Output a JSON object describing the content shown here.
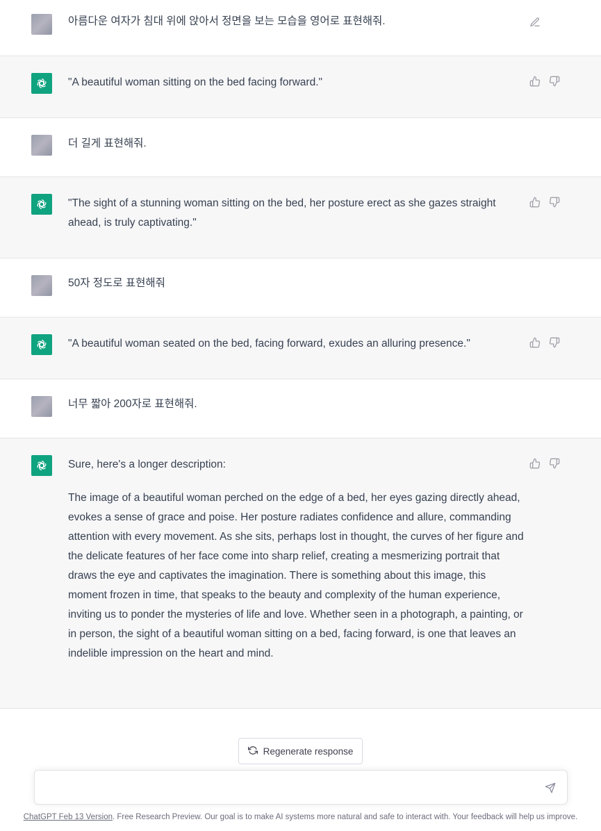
{
  "messages": [
    {
      "role": "user",
      "text": [
        "아름다운 여자가 침대 위에 앉아서 정면을 보는 모습을 영어로 표현해줘."
      ]
    },
    {
      "role": "assistant",
      "text": [
        "\"A beautiful woman sitting on the bed facing forward.\""
      ]
    },
    {
      "role": "user",
      "text": [
        "더 길게 표현해줘."
      ]
    },
    {
      "role": "assistant",
      "text": [
        "\"The sight of a stunning woman sitting on the bed, her posture erect as she gazes straight ahead, is truly captivating.\""
      ]
    },
    {
      "role": "user",
      "text": [
        "50자 정도로 표현해줘"
      ]
    },
    {
      "role": "assistant",
      "text": [
        "\"A beautiful woman seated on the bed, facing forward, exudes an alluring presence.\""
      ]
    },
    {
      "role": "user",
      "text": [
        "너무 짧아 200자로 표현해줘."
      ]
    },
    {
      "role": "assistant",
      "text": [
        "Sure, here's a longer description:",
        "The image of a beautiful woman perched on the edge of a bed, her eyes gazing directly ahead, evokes a sense of grace and poise. Her posture radiates confidence and allure, commanding attention with every movement. As she sits, perhaps lost in thought, the curves of her figure and the delicate features of her face come into sharp relief, creating a mesmerizing portrait that draws the eye and captivates the imagination. There is something about this image, this moment frozen in time, that speaks to the beauty and complexity of the human experience, inviting us to ponder the mysteries of life and love. Whether seen in a photograph, a painting, or in person, the sight of a beautiful woman sitting on a bed, facing forward, is one that leaves an indelible impression on the heart and mind."
      ]
    }
  ],
  "icons": {
    "user_action": "edit-icon",
    "assistant_actions": [
      "thumbs-up-icon",
      "thumbs-down-icon"
    ],
    "regenerate": "refresh-icon",
    "send": "send-icon"
  },
  "regenerate_label": "Regenerate response",
  "composer": {
    "placeholder": "",
    "value": ""
  },
  "footer": {
    "link_text": "ChatGPT Feb 13 Version",
    "text": ". Free Research Preview. Our goal is to make AI systems more natural and safe to interact with. Your feedback will help us improve."
  },
  "colors": {
    "assistant_avatar": "#10a37f",
    "assistant_bg": "#f7f7f8",
    "user_bg": "#ffffff"
  }
}
